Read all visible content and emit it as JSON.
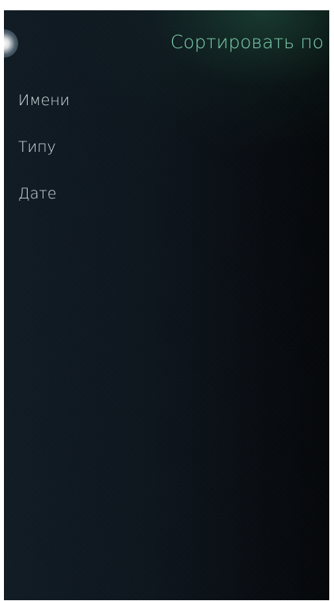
{
  "header": {
    "title": "Сортировать по"
  },
  "options": [
    {
      "label": "Имени"
    },
    {
      "label": "Типу"
    },
    {
      "label": "Дате"
    }
  ],
  "colors": {
    "accent": "#7fd3b0",
    "text": "#d6dde2",
    "background": "#0c141c"
  }
}
